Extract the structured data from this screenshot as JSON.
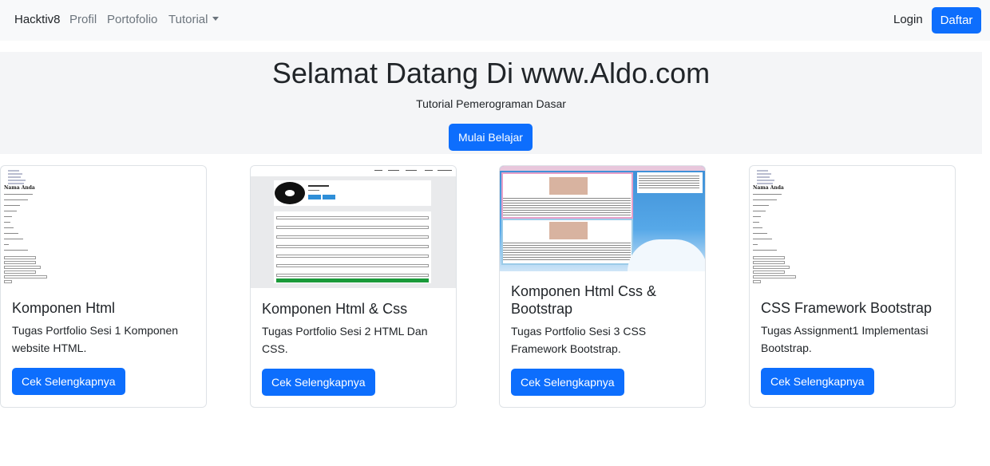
{
  "navbar": {
    "brand": "Hacktiv8",
    "links": [
      "Profil",
      "Portofolio",
      "Tutorial"
    ],
    "login": "Login",
    "signup": "Daftar"
  },
  "hero": {
    "title": "Selamat Datang Di www.Aldo.com",
    "subtitle": "Tutorial Pemerograman Dasar",
    "cta": "Mulai Belajar"
  },
  "cards": [
    {
      "title": "Komponen Html",
      "text": "Tugas Portfolio Sesi 1 Komponen website HTML.",
      "button": "Cek Selengkapnya",
      "thumb_heading": "Nama Anda"
    },
    {
      "title": "Komponen Html & Css",
      "text": "Tugas Portfolio Sesi 2 HTML Dan CSS.",
      "button": "Cek Selengkapnya"
    },
    {
      "title": "Komponen Html Css & Bootstrap",
      "text": "Tugas Portfolio Sesi 3 CSS Framework Bootstrap.",
      "button": "Cek Selengkapnya"
    },
    {
      "title": "CSS Framework Bootstrap",
      "text": "Tugas Assignment1 Implementasi Bootstrap.",
      "button": "Cek Selengkapnya",
      "thumb_heading": "Nama Anda"
    }
  ],
  "colors": {
    "primary": "#0d6efd",
    "navbar_bg": "#f8f9fa",
    "hero_bg": "#f4f5f7",
    "muted": "#6c757d"
  }
}
